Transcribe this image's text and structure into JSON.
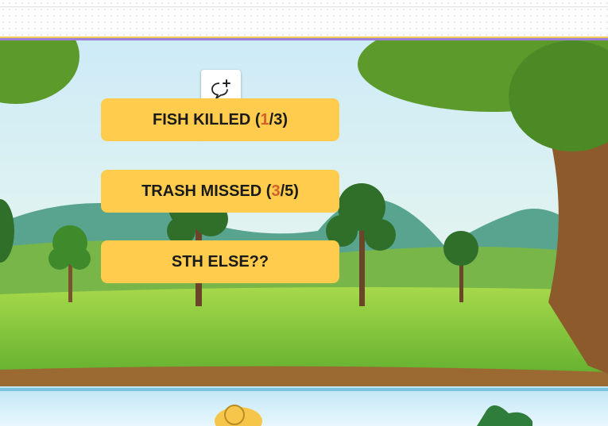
{
  "buttons": [
    {
      "label_prefix": "FISH KILLED (",
      "count": "1",
      "label_suffix": "/3)"
    },
    {
      "label_prefix": "TRASH MISSED (",
      "count": "3",
      "label_suffix": "/5)"
    },
    {
      "label": "STH ELSE??"
    }
  ],
  "icons": {
    "add_comment": "add-comment-icon"
  },
  "colors": {
    "button": "#ffcc4d",
    "highlight": "#d4612a",
    "grass": "#7fc234",
    "water": "#a9d8f0",
    "sky": "#dff2fa"
  }
}
